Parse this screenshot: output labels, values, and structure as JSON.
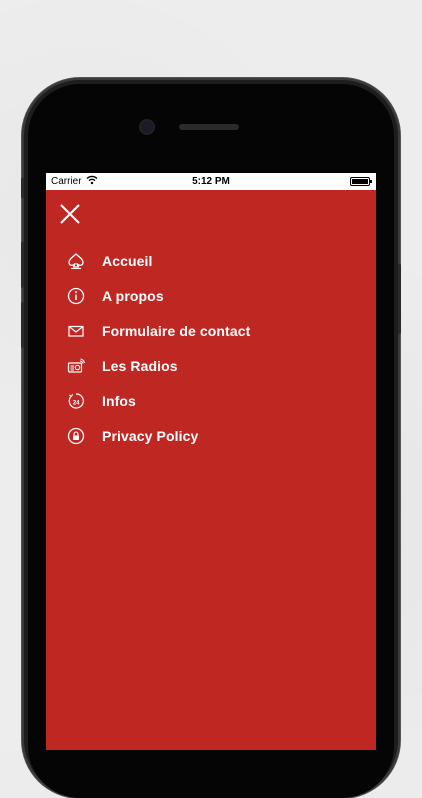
{
  "status_bar": {
    "carrier": "Carrier",
    "time": "5:12 PM"
  },
  "theme": {
    "accent": "#bf2722",
    "text": "#ffffff"
  },
  "menu": {
    "close_icon": "close-icon",
    "items": [
      {
        "label": "Accueil",
        "icon": "spade-home-icon"
      },
      {
        "label": "A propos",
        "icon": "info-icon"
      },
      {
        "label": "Formulaire de contact",
        "icon": "mail-icon"
      },
      {
        "label": "Les Radios",
        "icon": "radio-icon"
      },
      {
        "label": "Infos",
        "icon": "24h-icon"
      },
      {
        "label": "Privacy Policy",
        "icon": "lock-icon"
      }
    ]
  }
}
